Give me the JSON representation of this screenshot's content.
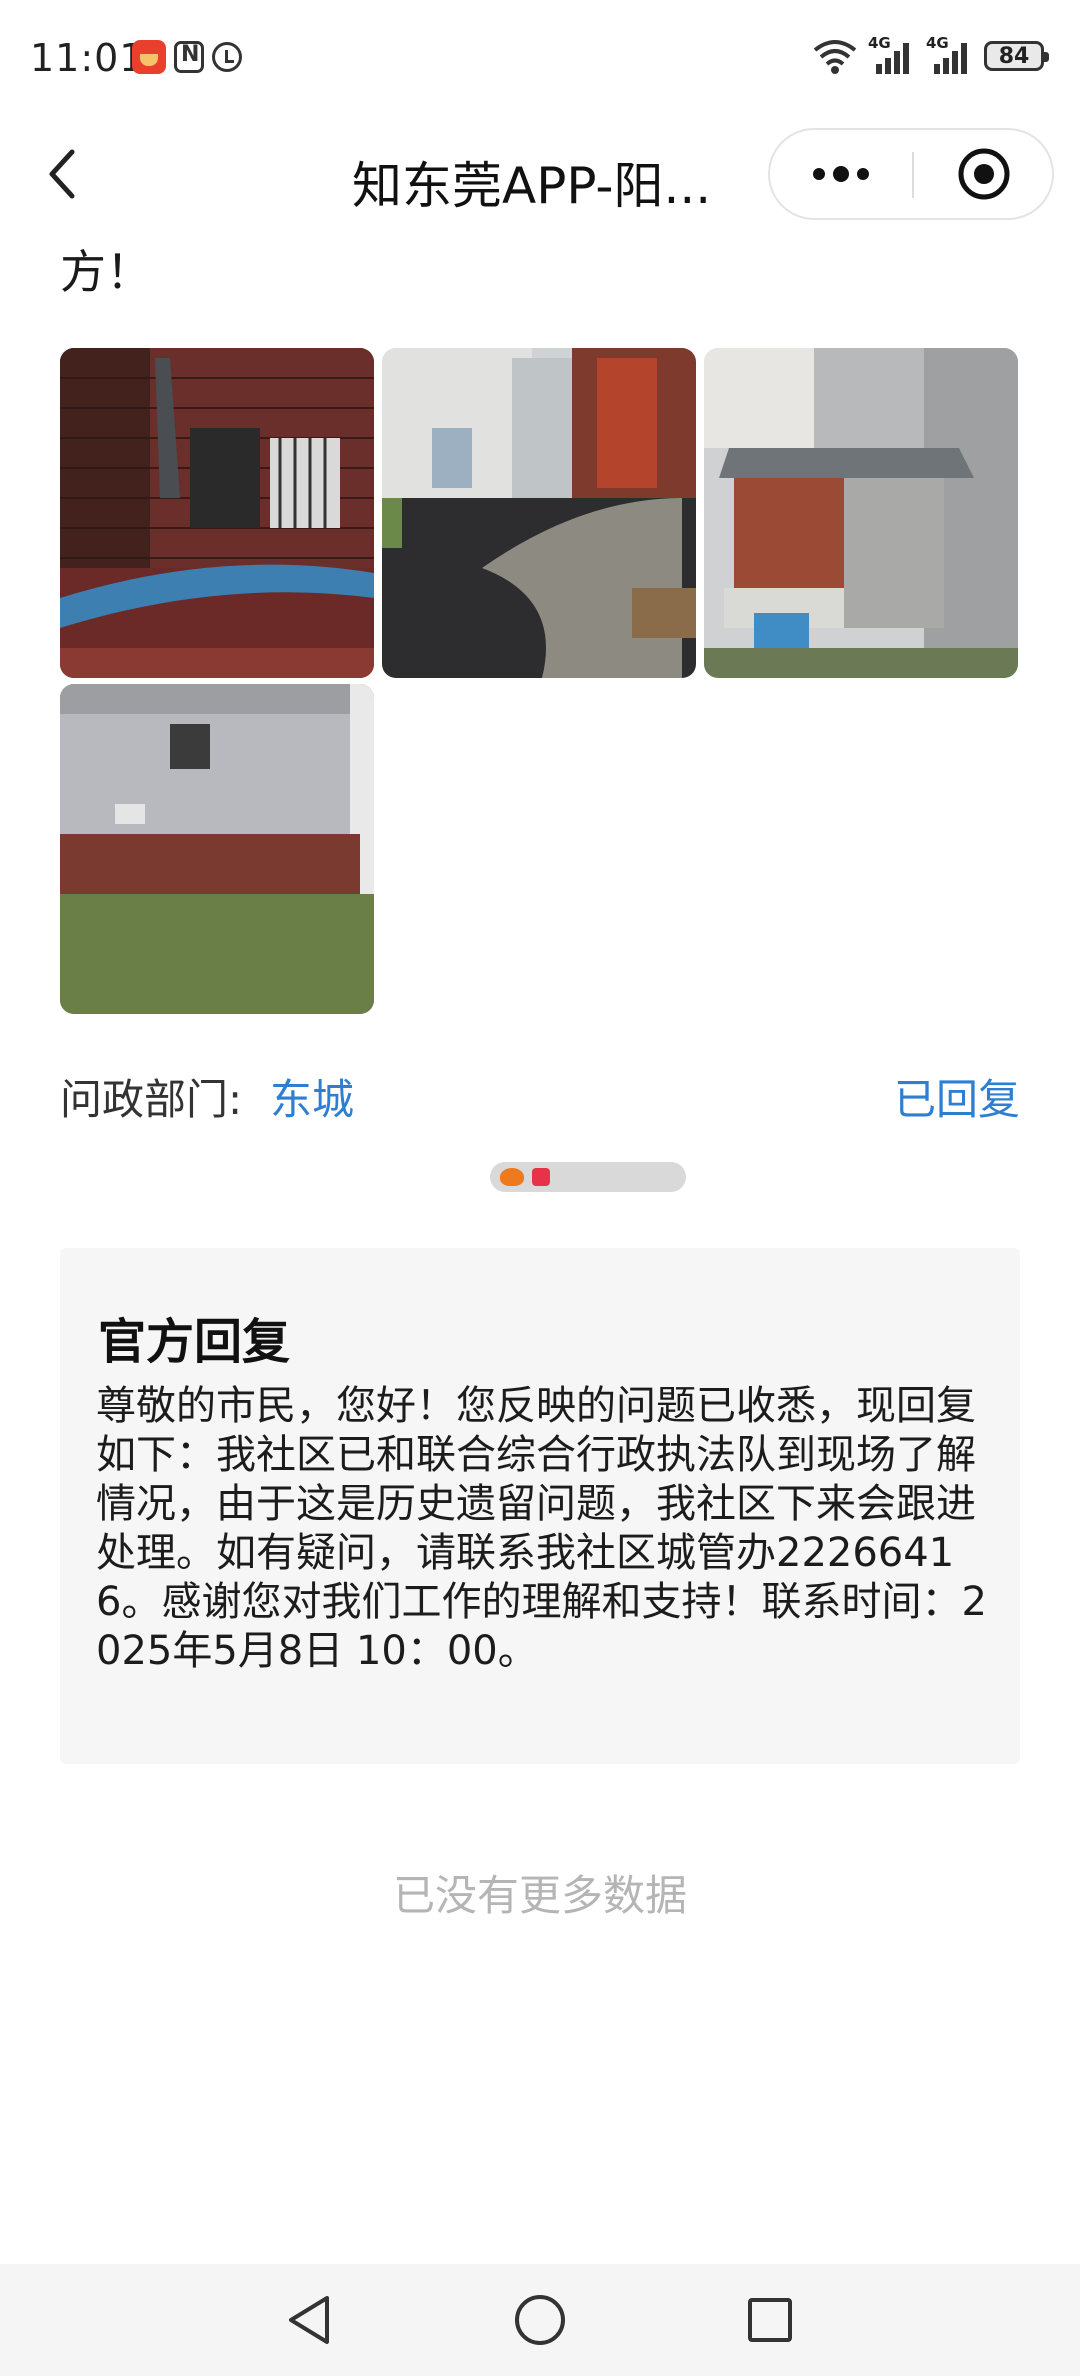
{
  "status_bar": {
    "time": "11:01",
    "signal_1": "4G",
    "signal_2": "4G",
    "battery": "84"
  },
  "header": {
    "title": "知东莞APP-阳...",
    "back_icon": "chevron-left-icon",
    "more_icon": "more-dots-icon",
    "close_icon": "target-circle-icon"
  },
  "content": {
    "partial_text": "方！",
    "photos": [
      {
        "name": "photo-1"
      },
      {
        "name": "photo-2"
      },
      {
        "name": "photo-3"
      },
      {
        "name": "photo-4"
      }
    ],
    "department_label": "问政部门:",
    "department_value": "东城",
    "reply_status": "已回复",
    "reply": {
      "title": "官方回复",
      "body": "尊敬的市民，您好！您反映的问题已收悉，现回复如下：我社区已和联合综合行政执法队到现场了解情况，由于这是历史遗留问题，我社区下来会跟进处理。如有疑问，请联系我社区城管办22266416。感谢您对我们工作的理解和支持！联系时间：2025年5月8日 10：00。"
    },
    "no_more": "已没有更多数据"
  },
  "colors": {
    "accent": "#2f7fd1",
    "card_bg": "#f6f6f6",
    "muted": "#b5b5b5"
  },
  "nav": {
    "back": "triangle-back-icon",
    "home": "circle-home-icon",
    "recents": "square-recents-icon"
  }
}
